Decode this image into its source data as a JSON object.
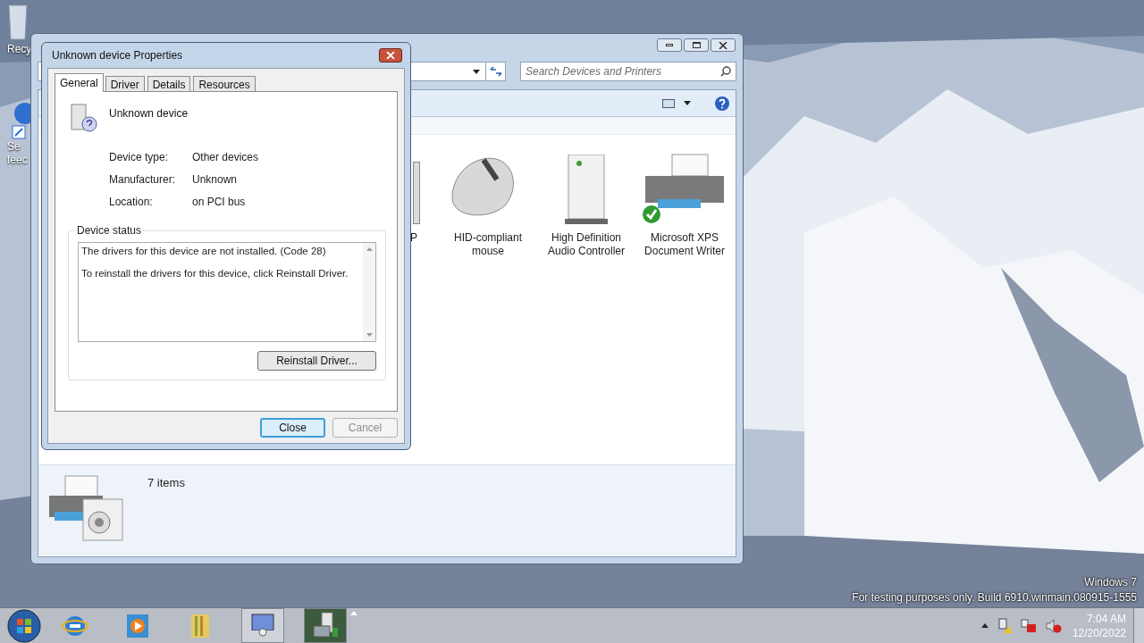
{
  "desktop": {
    "icons": [
      {
        "kind": "recycle",
        "lines": [
          "Recy"
        ]
      },
      {
        "kind": "feedback",
        "lines": [
          "Se",
          "feec"
        ]
      }
    ],
    "build_notice": [
      "Windows 7",
      "For testing purposes only. Build 6910.winmain.080915-1555"
    ]
  },
  "explorer": {
    "search": {
      "placeholder": "Search Devices and Printers"
    },
    "devices": [
      {
        "kind": "partial",
        "label": "P",
        "default": false
      },
      {
        "kind": "mouse",
        "label": "HID-compliant mouse",
        "default": false
      },
      {
        "kind": "tower",
        "label": "High Definition Audio Controller",
        "default": false
      },
      {
        "kind": "printer",
        "label": "Microsoft XPS Document Writer",
        "default": true
      }
    ],
    "status": "7 items"
  },
  "dialog": {
    "title": "Unknown device Properties",
    "tabs": [
      {
        "label": "General",
        "selected": true
      },
      {
        "label": "Driver",
        "selected": false
      },
      {
        "label": "Details",
        "selected": false
      },
      {
        "label": "Resources",
        "selected": false
      }
    ],
    "device_name": "Unknown device",
    "properties": [
      {
        "label": "Device type:",
        "value": "Other devices"
      },
      {
        "label": "Manufacturer:",
        "value": "Unknown"
      },
      {
        "label": "Location:",
        "value": "on PCI bus"
      }
    ],
    "status_group": "Device status",
    "status_lines": [
      "The drivers for this device are not installed. (Code 28)",
      "To reinstall the drivers for this device, click Reinstall Driver."
    ],
    "reinstall_button": "Reinstall Driver...",
    "buttons": [
      {
        "label": "Close",
        "default": true,
        "disabled": false
      },
      {
        "label": "Cancel",
        "default": false,
        "disabled": true
      }
    ]
  },
  "taskbar": {
    "items": [
      {
        "kind": "browser",
        "running": false,
        "selected": false
      },
      {
        "kind": "media",
        "running": false,
        "selected": false
      },
      {
        "kind": "library",
        "running": false,
        "selected": false
      },
      {
        "kind": "control",
        "running": true,
        "selected": false
      },
      {
        "kind": "device",
        "running": true,
        "selected": true
      }
    ],
    "clock": {
      "time": "7:04 AM",
      "date": "12/20/2022"
    }
  }
}
